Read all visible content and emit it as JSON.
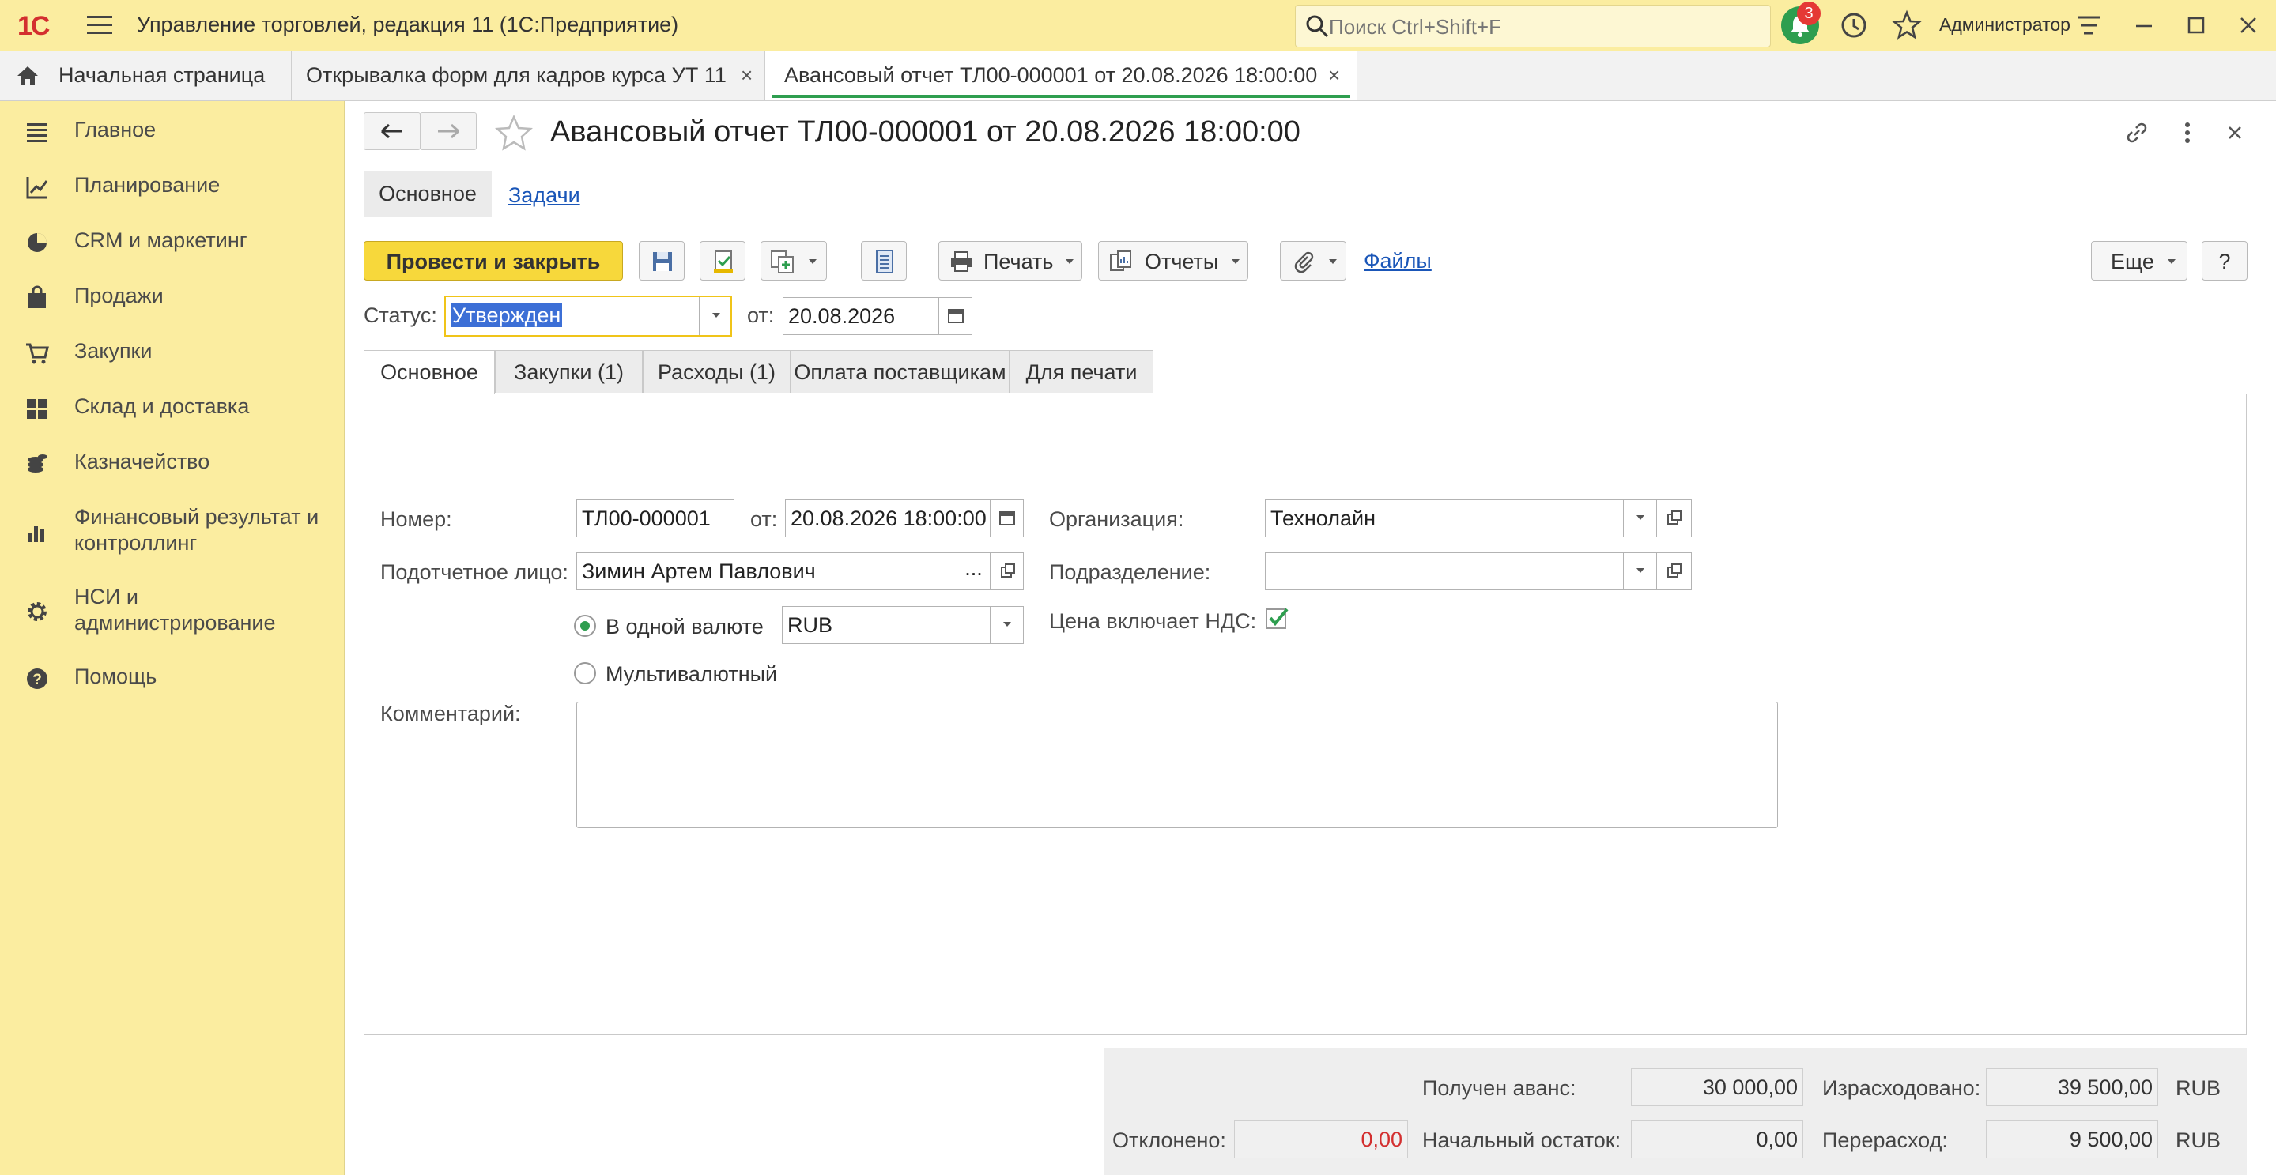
{
  "app": {
    "logo_text": "1С",
    "title": "Управление торговлей, редакция 11  (1С:Предприятие)",
    "search_placeholder": "Поиск Ctrl+Shift+F",
    "notifications_count": "3",
    "user": "Администратор",
    "accent_color": "#2e9e4f"
  },
  "window_tabs": [
    {
      "label": "Начальная страница",
      "icon": "home-icon"
    },
    {
      "label": "Открывалка форм для кадров курса УТ 11",
      "close": "×"
    },
    {
      "label": "Авансовый отчет ТЛ00-000001 от 20.08.2026 18:00:00",
      "close": "×",
      "active": true
    }
  ],
  "sidebar": {
    "items": [
      {
        "label": "Главное",
        "icon": "menu-lines-icon"
      },
      {
        "label": "Планирование",
        "icon": "planning-chart-icon"
      },
      {
        "label": "CRM и маркетинг",
        "icon": "pie-chart-icon"
      },
      {
        "label": "Продажи",
        "icon": "shopping-bag-icon"
      },
      {
        "label": "Закупки",
        "icon": "cart-icon"
      },
      {
        "label": "Склад и доставка",
        "icon": "warehouse-grid-icon"
      },
      {
        "label": "Казначейство",
        "icon": "coins-icon"
      },
      {
        "label": "Финансовый результат и",
        "label2": "контроллинг",
        "icon": "bar-chart-icon"
      },
      {
        "label": "НСИ и",
        "label2": "администрирование",
        "icon": "gear-icon"
      },
      {
        "label": "Помощь",
        "icon": "help-icon"
      }
    ]
  },
  "document": {
    "title": "Авансовый отчет ТЛ00-000001 от 20.08.2026 18:00:00",
    "section_tabs": [
      "Основное",
      "Задачи"
    ],
    "toolbar": {
      "post_close": "Провести и закрыть",
      "print": "Печать",
      "reports": "Отчеты",
      "files": "Файлы",
      "more": "Еще",
      "help": "?"
    },
    "status_label": "Статус:",
    "status_value": "Утвержден",
    "status_date_label": "от:",
    "status_date": "20.08.2026",
    "form_tabs": [
      "Основное",
      "Закупки (1)",
      "Расходы (1)",
      "Оплата поставщикам",
      "Для печати"
    ],
    "fields": {
      "number_label": "Номер:",
      "number": "ТЛ00-000001",
      "date_label": "от:",
      "date": "20.08.2026 18:00:00",
      "org_label": "Организация:",
      "org": "Технолайн",
      "person_label": "Подотчетное лицо:",
      "person": "Зимин Артем Павлович",
      "dept_label": "Подразделение:",
      "dept": "",
      "single_currency": "В одной валюте",
      "currency": "RUB",
      "multi_currency": "Мультивалютный",
      "vat_label": "Цена включает НДС:",
      "comment_label": "Комментарий:",
      "comment": "",
      "ellipsis": "..."
    },
    "totals": {
      "advance_label": "Получен аванс:",
      "advance": "30 000,00",
      "spent_label": "Израсходовано:",
      "spent": "39 500,00",
      "rejected_label": "Отклонено:",
      "rejected": "0,00",
      "opening_label": "Начальный остаток:",
      "opening": "0,00",
      "overspend_label": "Перерасход:",
      "overspend": "9 500,00",
      "currency": "RUB",
      "rejected_color": "#d32f2f"
    }
  }
}
